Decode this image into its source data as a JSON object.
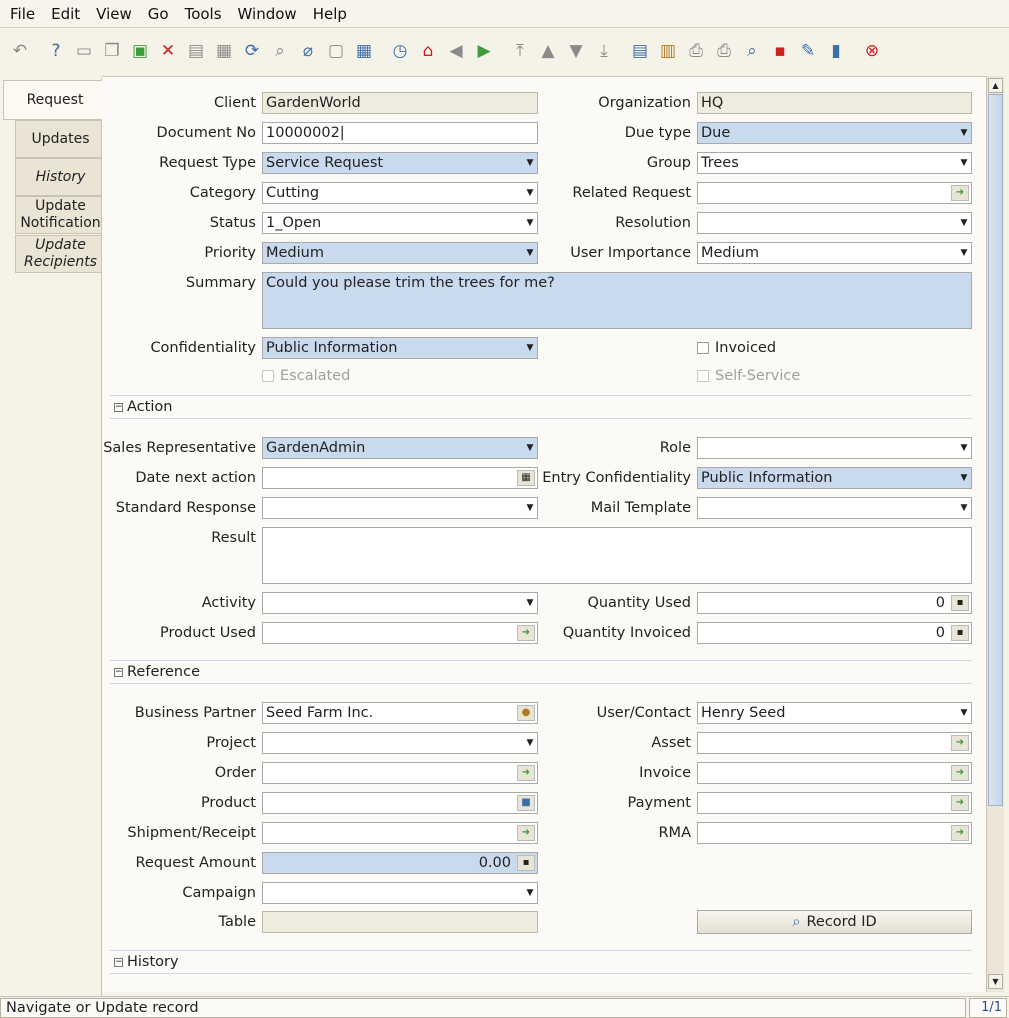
{
  "menu": {
    "file": "File",
    "edit": "Edit",
    "view": "View",
    "go": "Go",
    "tools": "Tools",
    "window": "Window",
    "help": "Help"
  },
  "toolbar_icons": [
    "undo-icon",
    "help-icon",
    "new-icon",
    "copy-icon",
    "save-icon",
    "delete-icon",
    "save-disabled-icon",
    "save-new-icon",
    "refresh-icon",
    "find-icon",
    "attachment-icon",
    "chat-icon",
    "grid-toggle-icon",
    "history-icon",
    "home-icon",
    "previous-icon",
    "next-icon",
    "first-record-icon",
    "previous-record-icon",
    "next-record-icon",
    "last-record-icon",
    "report-icon",
    "archive-icon",
    "print-preview-icon",
    "print-icon",
    "zoom-across-icon",
    "workflow-icon",
    "request-icon",
    "product-info-icon",
    "exit-icon"
  ],
  "tabs": [
    "Request",
    "Updates",
    "History",
    "Update Notification",
    "Update Recipients"
  ],
  "form": {
    "client_label": "Client",
    "client": "GardenWorld",
    "org_label": "Organization",
    "org": "HQ",
    "docno_label": "Document No",
    "docno": "10000002",
    "duetype_label": "Due type",
    "duetype": "Due",
    "reqtype_label": "Request Type",
    "reqtype": "Service Request",
    "group_label": "Group",
    "group": "Trees",
    "category_label": "Category",
    "category": "Cutting",
    "related_label": "Related Request",
    "related": "",
    "status_label": "Status",
    "status": "1_Open",
    "resolution_label": "Resolution",
    "resolution": "",
    "priority_label": "Priority",
    "priority": "Medium",
    "userimp_label": "User Importance",
    "userimp": "Medium",
    "summary_label": "Summary",
    "summary": "Could you please trim the trees for me?",
    "conf_label": "Confidentiality",
    "conf": "Public Information",
    "invoiced_label": "Invoiced",
    "escalated_label": "Escalated",
    "selfservice_label": "Self-Service"
  },
  "action": {
    "title": "Action",
    "salesrep_label": "Sales Representative",
    "salesrep": "GardenAdmin",
    "role_label": "Role",
    "role": "",
    "datenext_label": "Date next action",
    "datenext": "",
    "entryconf_label": "Entry Confidentiality",
    "entryconf": "Public Information",
    "stdresp_label": "Standard Response",
    "stdresp": "",
    "mailtpl_label": "Mail Template",
    "mailtpl": "",
    "result_label": "Result",
    "result": "",
    "activity_label": "Activity",
    "activity": "",
    "qtyused_label": "Quantity Used",
    "qtyused": "0",
    "product_used_label": "Product Used",
    "product_used": "",
    "qtyinv_label": "Quantity Invoiced",
    "qtyinv": "0"
  },
  "reference": {
    "title": "Reference",
    "bpartner_label": "Business Partner",
    "bpartner": "Seed Farm Inc.",
    "user_label": "User/Contact",
    "user": "Henry Seed",
    "project_label": "Project",
    "project": "",
    "asset_label": "Asset",
    "asset": "",
    "order_label": "Order",
    "order": "",
    "invoice_label": "Invoice",
    "invoice": "",
    "product_label": "Product",
    "product": "",
    "payment_label": "Payment",
    "payment": "",
    "shipment_label": "Shipment/Receipt",
    "shipment": "",
    "rma_label": "RMA",
    "rma": "",
    "reqamt_label": "Request Amount",
    "reqamt": "0.00",
    "campaign_label": "Campaign",
    "campaign": "",
    "table_label": "Table",
    "table": "",
    "recordid_label": "Record ID"
  },
  "history_section": {
    "title": "History"
  },
  "status": {
    "message": "Navigate or Update record",
    "record": "1/1"
  }
}
